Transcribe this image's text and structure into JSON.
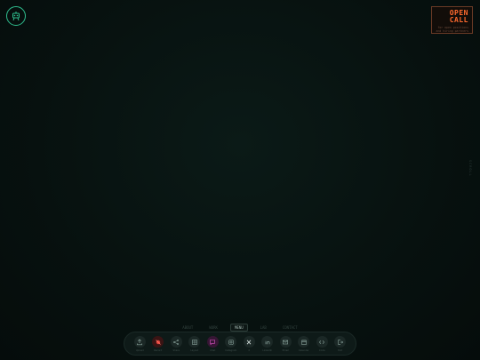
{
  "brand": {
    "logo_icon": "robot-icon",
    "accent": "#2fbf8f"
  },
  "badge": {
    "line1": "OPEN",
    "line2": "CALL",
    "subtitle": "for open positions and hiring partners",
    "color": "#ff6a2e"
  },
  "side_label": "SCROLL",
  "nav_menu": {
    "items": [
      {
        "label": "ABOUT"
      },
      {
        "label": "WORK"
      },
      {
        "label": "MENU",
        "active": true
      },
      {
        "label": "LAB"
      },
      {
        "label": "CONTACT"
      }
    ]
  },
  "dock": {
    "items": [
      {
        "label": "Upload",
        "icon": "upload-icon"
      },
      {
        "label": "Record",
        "icon": "record-icon"
      },
      {
        "label": "Share",
        "icon": "share-icon"
      },
      {
        "label": "Layout",
        "icon": "grid-icon"
      },
      {
        "label": "Chat",
        "icon": "chat-icon"
      },
      {
        "label": "Instagram",
        "icon": "instagram-icon"
      },
      {
        "label": "X",
        "icon": "x-icon"
      },
      {
        "label": "LinkedIn",
        "icon": "linkedin-icon"
      },
      {
        "label": "Email",
        "icon": "mail-icon"
      },
      {
        "label": "Calendar",
        "icon": "calendar-icon"
      },
      {
        "label": "Code",
        "icon": "code-icon"
      },
      {
        "label": "Exit",
        "icon": "logout-icon"
      }
    ]
  }
}
